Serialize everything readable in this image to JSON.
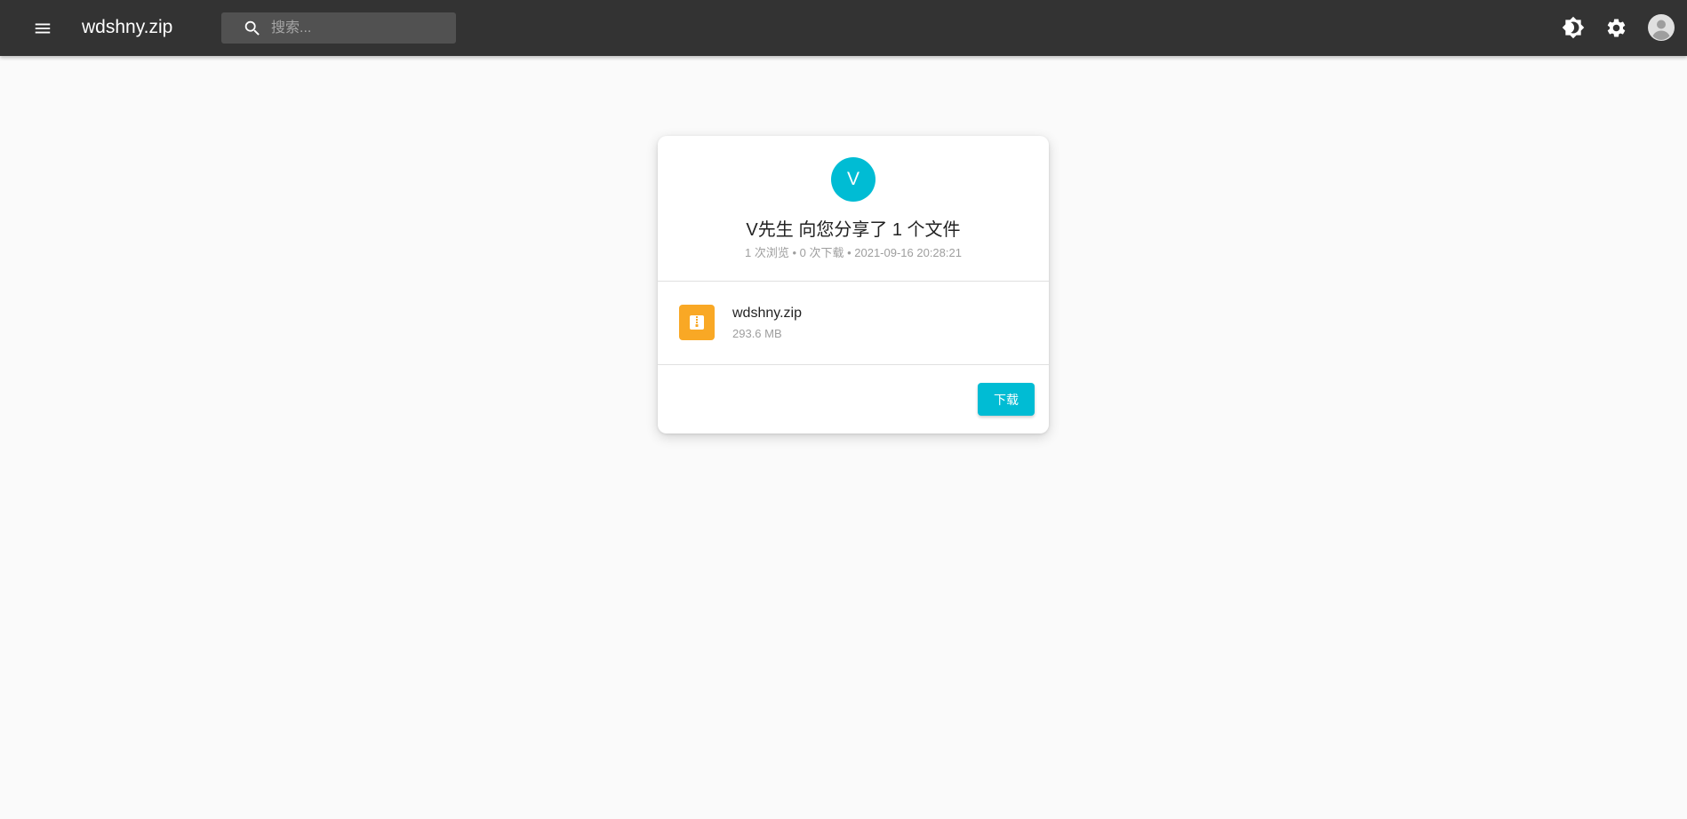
{
  "header": {
    "title": "wdshny.zip",
    "search": {
      "placeholder": "搜索...",
      "value": ""
    },
    "icons": {
      "menu": "menu-icon",
      "search": "search-icon",
      "theme": "brightness-icon",
      "settings": "gear-icon",
      "account": "account-icon"
    }
  },
  "share": {
    "avatar_letter": "V",
    "title": "V先生 向您分享了 1 个文件",
    "meta": "1 次浏览 • 0 次下载 • 2021-09-16 20:28:21"
  },
  "file": {
    "name": "wdshny.zip",
    "size": "293.6 MB",
    "icon": "zip-file-icon"
  },
  "actions": {
    "download_label": "下载"
  },
  "colors": {
    "appbar": "#333333",
    "accent": "#00bcd4",
    "file_icon": "#f9a825",
    "background": "#fafafa"
  }
}
